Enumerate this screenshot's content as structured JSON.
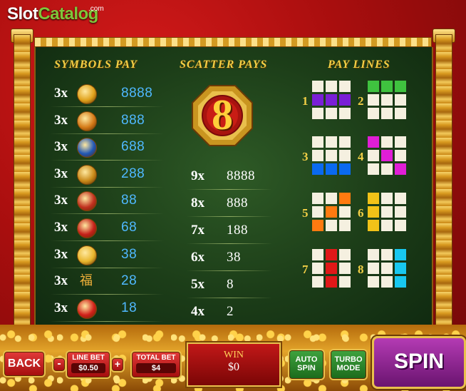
{
  "logo": {
    "slot": "Slot",
    "catalog": "Catalog",
    "com": ".com"
  },
  "headers": {
    "symbols": "SYMBOLS PAY",
    "scatter": "SCATTER PAYS",
    "lines": "PAY LINES"
  },
  "symbols": [
    {
      "mult": "3x",
      "pay": "8888",
      "icon": "gold-dragon-icon",
      "color": "#e0a21c"
    },
    {
      "mult": "3x",
      "pay": "888",
      "icon": "golden-lion-icon",
      "color": "#d47a18"
    },
    {
      "mult": "3x",
      "pay": "688",
      "icon": "blue-koi-icon",
      "color": "#1f56b5"
    },
    {
      "mult": "3x",
      "pay": "288",
      "icon": "gold-coin-dragon-icon",
      "color": "#c98a1a"
    },
    {
      "mult": "3x",
      "pay": "88",
      "icon": "gold-ingot-bowl-icon",
      "color": "#c0301f"
    },
    {
      "mult": "3x",
      "pay": "68",
      "icon": "red-lantern-icon",
      "color": "#c5201a"
    },
    {
      "mult": "3x",
      "pay": "38",
      "icon": "gold-ingot-icon",
      "color": "#e8b52c"
    },
    {
      "mult": "3x",
      "pay": "28",
      "icon": "fu-character-icon",
      "glyph": "福",
      "color": "#e0a21c"
    },
    {
      "mult": "3x",
      "pay": "18",
      "icon": "chinese-knot-icon",
      "color": "#d2201a"
    }
  ],
  "scatter": {
    "symbol": "8",
    "rows": [
      {
        "mult": "9x",
        "pay": "8888"
      },
      {
        "mult": "8x",
        "pay": "888"
      },
      {
        "mult": "7x",
        "pay": "188"
      },
      {
        "mult": "6x",
        "pay": "38"
      },
      {
        "mult": "5x",
        "pay": "8"
      },
      {
        "mult": "4x",
        "pay": "2"
      }
    ]
  },
  "paylines": [
    {
      "num": "1",
      "color": "#7a1fd6",
      "cells": [
        0,
        0,
        0,
        1,
        1,
        1,
        0,
        0,
        0
      ]
    },
    {
      "num": "2",
      "color": "#3fc23f",
      "cells": [
        1,
        1,
        1,
        0,
        0,
        0,
        0,
        0,
        0
      ]
    },
    {
      "num": "3",
      "color": "#0a6af0",
      "cells": [
        0,
        0,
        0,
        0,
        0,
        0,
        1,
        1,
        1
      ]
    },
    {
      "num": "4",
      "color": "#e01ed6",
      "cells": [
        1,
        0,
        0,
        0,
        1,
        0,
        0,
        0,
        1
      ]
    },
    {
      "num": "5",
      "color": "#ff7a10",
      "cells": [
        0,
        0,
        1,
        0,
        1,
        0,
        1,
        0,
        0
      ]
    },
    {
      "num": "6",
      "color": "#f2c218",
      "cells": [
        1,
        0,
        0,
        1,
        0,
        0,
        1,
        0,
        0
      ]
    },
    {
      "num": "7",
      "color": "#e01818",
      "cells": [
        0,
        1,
        0,
        0,
        1,
        0,
        0,
        1,
        0
      ]
    },
    {
      "num": "8",
      "color": "#18c8f0",
      "cells": [
        0,
        0,
        1,
        0,
        0,
        1,
        0,
        0,
        1
      ]
    }
  ],
  "controls": {
    "back": "BACK",
    "minus": "-",
    "plus": "+",
    "line_bet_label": "LINE BET",
    "line_bet_value": "$0.50",
    "total_bet_label": "TOTAL BET",
    "total_bet_value": "$4",
    "win_label": "WIN",
    "win_value": "$0",
    "auto_spin_1": "AUTO",
    "auto_spin_2": "SPIN",
    "turbo_1": "TURBO",
    "turbo_2": "MODE",
    "spin": "SPIN"
  }
}
